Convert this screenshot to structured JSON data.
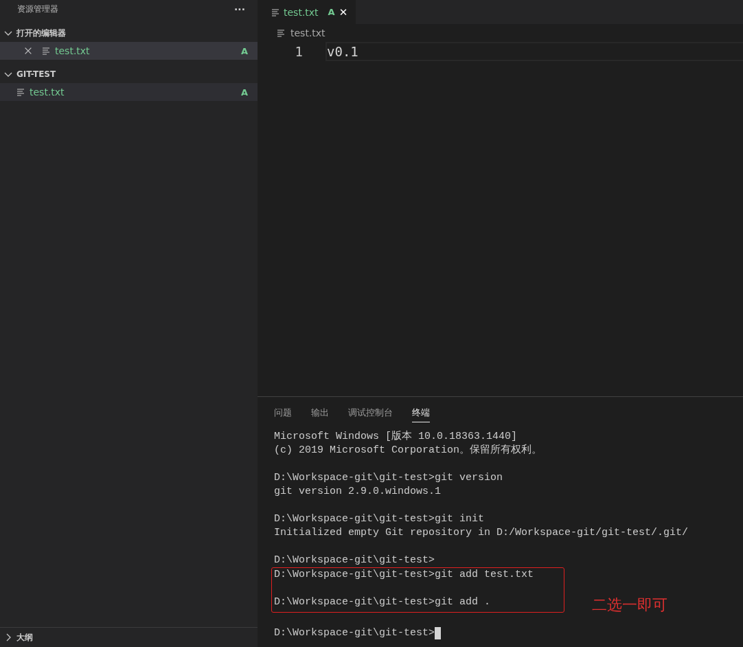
{
  "sidebar": {
    "title": "资源管理器",
    "more": "···",
    "sections": [
      {
        "title": "打开的编辑器",
        "expanded": true,
        "items": [
          {
            "label": "test.txt",
            "status": "A",
            "selected": true,
            "closable": true
          }
        ]
      },
      {
        "title": "GIT-TEST",
        "expanded": true,
        "items": [
          {
            "label": "test.txt",
            "status": "A",
            "selected": false,
            "closable": false
          }
        ]
      }
    ],
    "outline": {
      "title": "大纲",
      "expanded": false
    }
  },
  "editor": {
    "tabs": [
      {
        "label": "test.txt",
        "status": "A",
        "selected": true,
        "close": "✕"
      }
    ],
    "breadcrumb": "test.txt",
    "lines": [
      {
        "number": "1",
        "text": "v0.1"
      }
    ]
  },
  "panel": {
    "tabs": [
      {
        "label": "问题",
        "selected": false
      },
      {
        "label": "输出",
        "selected": false
      },
      {
        "label": "调试控制台",
        "selected": false
      },
      {
        "label": "终端",
        "selected": true
      }
    ],
    "terminal": [
      {
        "kind": "text",
        "lines": [
          "Microsoft Windows [版本 10.0.18363.1440]",
          "(c) 2019 Microsoft Corporation。保留所有权利。"
        ]
      },
      {
        "kind": "text",
        "lines": [
          "D:\\Workspace-git\\git-test>git version",
          "git version 2.9.0.windows.1"
        ]
      },
      {
        "kind": "text",
        "lines": [
          "D:\\Workspace-git\\git-test>git init",
          "Initialized empty Git repository in D:/Workspace-git/git-test/.git/"
        ]
      },
      {
        "kind": "text",
        "lines": [
          "D:\\Workspace-git\\git-test>"
        ],
        "tight": true
      },
      {
        "kind": "highlight",
        "lines": [
          "D:\\Workspace-git\\git-test>git add test.txt",
          "D:\\Workspace-git\\git-test>git add ."
        ],
        "note": "二选一即可"
      },
      {
        "kind": "prompt",
        "lines": [
          "D:\\Workspace-git\\git-test>"
        ],
        "cursor": true
      }
    ]
  }
}
